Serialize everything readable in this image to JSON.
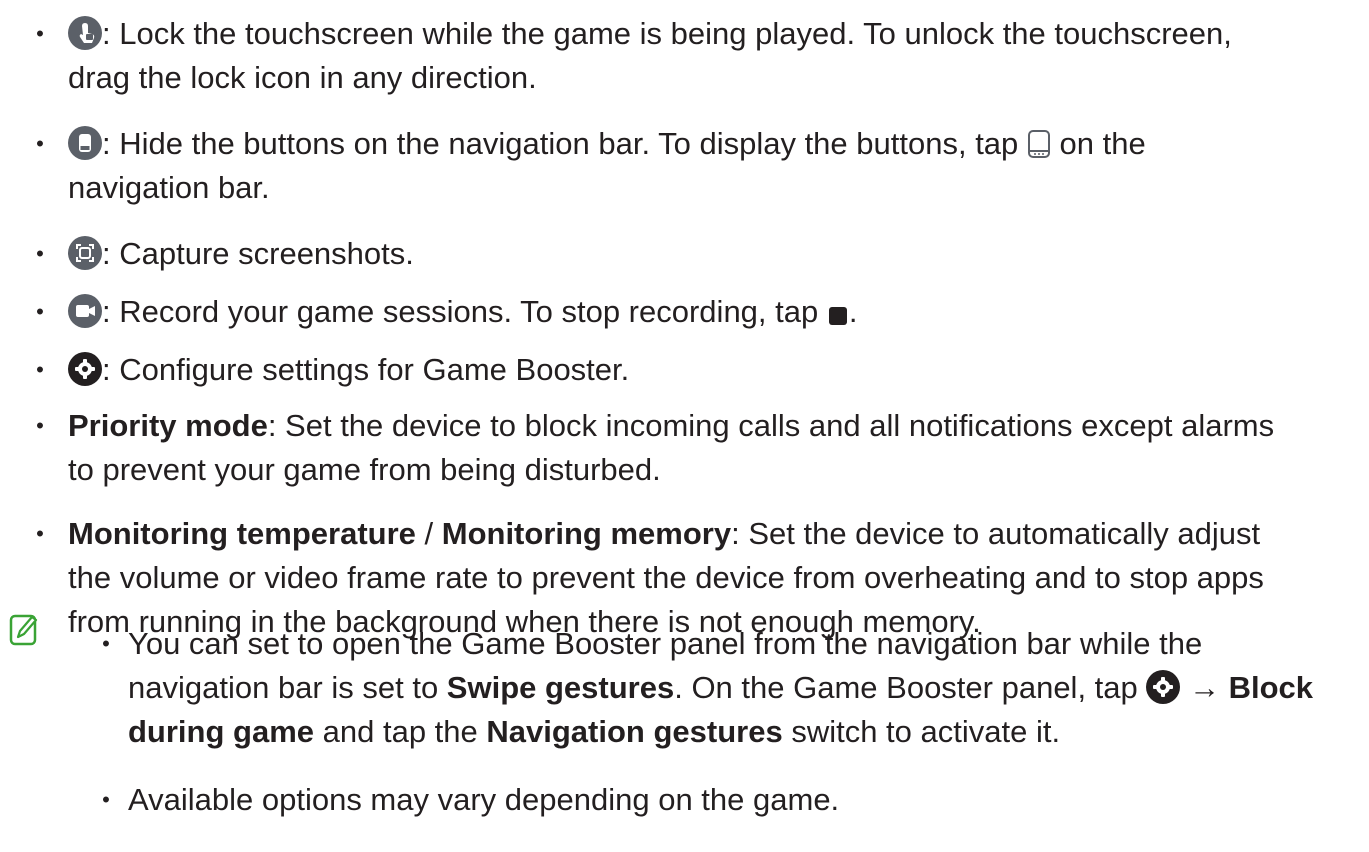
{
  "items": [
    {
      "icon": "touch-lock-icon",
      "lines": [
        ": Lock the touchscreen while the game is being played. To unlock the touchscreen,",
        "drag the lock icon in any direction."
      ]
    },
    {
      "icon": "navigation-bar-hide-icon",
      "line1_before": ": Hide the buttons on the navigation bar. To display the buttons, tap",
      "inline_icon": "navigation-bar-icon",
      "line1_after": " on the",
      "line2": "navigation bar."
    },
    {
      "icon": "screenshot-icon",
      "lines": [
        ": Capture screenshots."
      ]
    },
    {
      "icon": "video-record-icon",
      "line1_before": ": Record your game sessions. To stop recording, tap",
      "inline_icon": "stop-square-icon",
      "line1_after": "."
    },
    {
      "icon": "gear-icon",
      "lines": [
        ": Configure settings for Game Booster."
      ]
    },
    {
      "bold": "Priority mode",
      "line1": ": Set the device to block incoming calls and all notifications except alarms",
      "line2": "to prevent your game from being disturbed."
    },
    {
      "bold1": "Monitoring temperature",
      "sep": " / ",
      "bold2": "Monitoring memory",
      "line1": ": Set the device to automatically adjust",
      "line2": "the volume or video frame rate to prevent the device from overheating and to stop apps",
      "line3": "from running in the background when there is not enough memory."
    }
  ],
  "note": {
    "icon": "note-pencil-icon",
    "item1": {
      "l1": "You can set to open the Game Booster panel from the navigation bar while the",
      "l2_before": "navigation bar is set to ",
      "l2_bold1": "Swipe gestures",
      "l2_mid": ". On the Game Booster panel, tap ",
      "l2_arrow": " → ",
      "l2_bold2": "Block",
      "l3_bold1": "during game",
      "l3_mid": " and tap the ",
      "l3_bold2": "Navigation gestures",
      "l3_after": " switch to activate it."
    },
    "item2": "Available options may vary depending on the game."
  },
  "bullet": "•",
  "colors": {
    "icon_bg": "#5b6068",
    "text": "#231f20",
    "note_icon": "#3aa335"
  }
}
